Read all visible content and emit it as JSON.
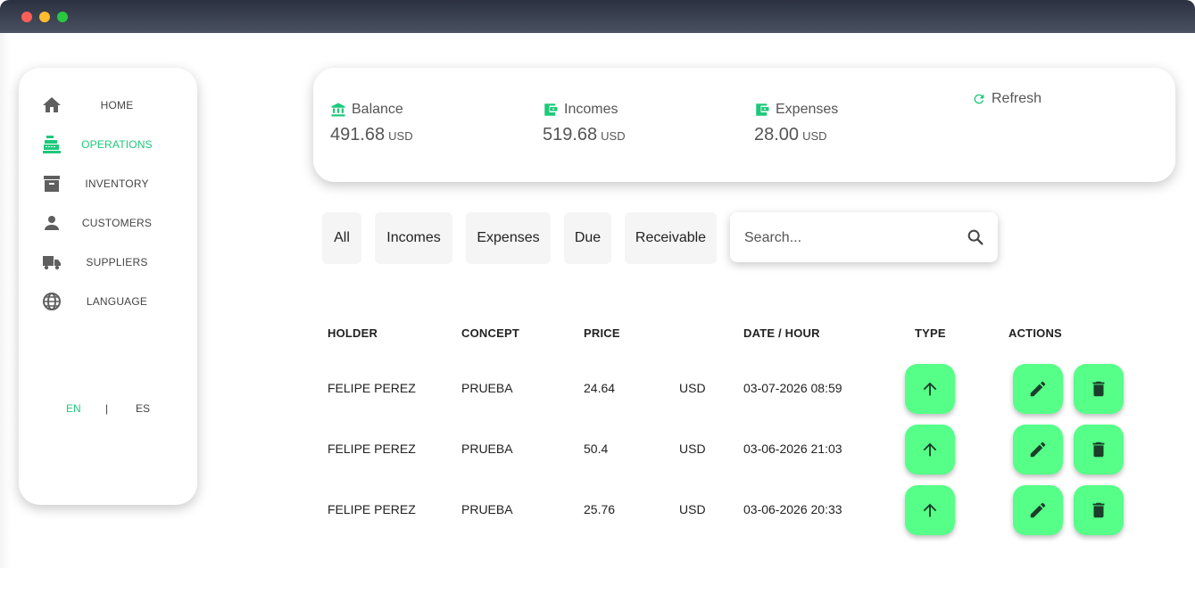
{
  "sidebar": {
    "items": [
      {
        "label": "HOME",
        "icon": "home-icon"
      },
      {
        "label": "OPERATIONS",
        "icon": "cash-register-icon"
      },
      {
        "label": "INVENTORY",
        "icon": "archive-icon"
      },
      {
        "label": "CUSTOMERS",
        "icon": "person-icon"
      },
      {
        "label": "SUPPLIERS",
        "icon": "truck-icon"
      },
      {
        "label": "LANGUAGE",
        "icon": "globe-icon"
      }
    ],
    "active_item": "OPERATIONS",
    "lang": {
      "en": "EN",
      "sep": "|",
      "es": "ES",
      "active": "EN"
    }
  },
  "summary": {
    "balance": {
      "label": "Balance",
      "value": "491.68",
      "currency": "USD",
      "icon": "bank-icon"
    },
    "incomes": {
      "label": "Incomes",
      "value": "519.68",
      "currency": "USD",
      "icon": "wallet-icon"
    },
    "expenses": {
      "label": "Expenses",
      "value": "28.00",
      "currency": "USD",
      "icon": "wallet-icon"
    },
    "refresh_label": "Refresh"
  },
  "filters": [
    "All",
    "Incomes",
    "Expenses",
    "Due",
    "Receivable"
  ],
  "search": {
    "placeholder": "Search...",
    "value": ""
  },
  "table": {
    "headers": {
      "holder": "HOLDER",
      "concept": "CONCEPT",
      "price": "PRICE",
      "date": "DATE / HOUR",
      "type": "TYPE",
      "actions": "ACTIONS"
    },
    "rows": [
      {
        "holder": "FELIPE PEREZ",
        "concept": "PRUEBA",
        "price": "24.64",
        "currency": "USD",
        "date": "03-07-2026 08:59",
        "type": "income"
      },
      {
        "holder": "FELIPE PEREZ",
        "concept": "PRUEBA",
        "price": "50.4",
        "currency": "USD",
        "date": "03-06-2026 21:03",
        "type": "income"
      },
      {
        "holder": "FELIPE PEREZ",
        "concept": "PRUEBA",
        "price": "25.76",
        "currency": "USD",
        "date": "03-06-2026 20:33",
        "type": "income"
      }
    ]
  },
  "colors": {
    "accent": "#1ec97a",
    "action_button": "#55ff88",
    "icon_gray": "#5f5f5f",
    "titlebar": "#2b3140"
  }
}
